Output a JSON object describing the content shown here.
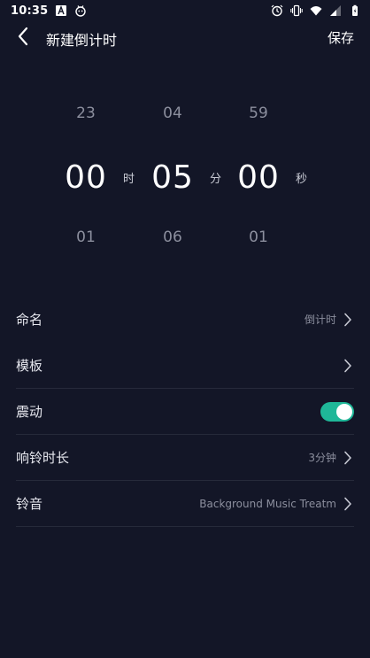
{
  "status_bar": {
    "time": "10:35",
    "icons": [
      "a-icon",
      "android-debug-icon",
      "alarm-icon",
      "vibrate-icon",
      "wifi-icon",
      "signal-icon",
      "battery-icon"
    ]
  },
  "header": {
    "title": "新建倒计时",
    "save_label": "保存",
    "back_icon": "chevron-left-icon"
  },
  "picker": {
    "hours": {
      "prev": "23",
      "current": "00",
      "next": "01",
      "unit": "时"
    },
    "minutes": {
      "prev": "04",
      "current": "05",
      "next": "06",
      "unit": "分"
    },
    "seconds": {
      "prev": "59",
      "current": "00",
      "next": "01",
      "unit": "秒"
    }
  },
  "settings": {
    "name": {
      "label": "命名",
      "value": "倒计时"
    },
    "template": {
      "label": "模板"
    },
    "vibrate": {
      "label": "震动",
      "enabled": true
    },
    "ring_duration": {
      "label": "响铃时长",
      "value": "3分钟"
    },
    "ringtone": {
      "label": "铃音",
      "value": "Background Music Treatm"
    }
  },
  "colors": {
    "background": "#131627",
    "toggle_on": "#1fb798",
    "divider": "#262a3a",
    "muted_text": "#8c8f9e"
  }
}
